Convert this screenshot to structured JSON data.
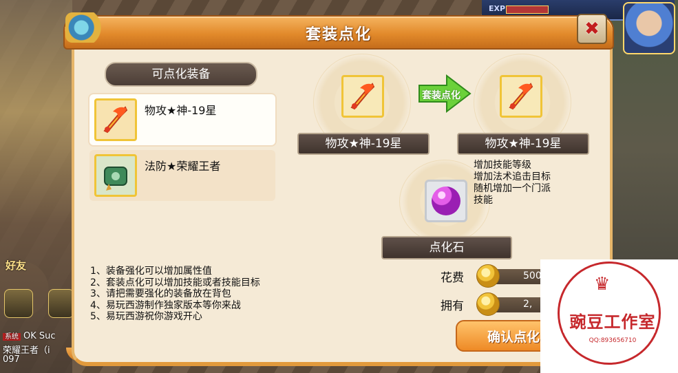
{
  "window": {
    "title": "套装点化",
    "close_icon": "close-icon"
  },
  "hud": {
    "exp_label": "EXP",
    "friend_label": "好友"
  },
  "chat": {
    "line1_tag": "系统",
    "line1_text": "OK  Suc",
    "line2_text": "荣耀王者（i",
    "line3_text": "097"
  },
  "left": {
    "section_label": "可点化装备",
    "items": [
      {
        "name": "物攻★神-19星",
        "icon": "flaming-sword-icon",
        "selected": true
      },
      {
        "name": "法防★荣耀王者",
        "icon": "jade-armor-icon",
        "selected": false
      }
    ]
  },
  "transform": {
    "arrow_label": "套装点化",
    "source_name": "物攻★神-19星",
    "target_name": "物攻★神-19星",
    "effects": [
      "增加技能等级",
      "增加法术追击目标",
      "随机增加一个门派",
      "技能"
    ]
  },
  "stone": {
    "label": "点化石",
    "icon": "purple-orb-icon"
  },
  "notes": [
    "1、装备强化可以增加属性值",
    "2、套装点化可以增加技能或者技能目标",
    "3、请把需要强化的装备放在背包",
    "4、易玩西游制作独家版本等你来战",
    "5、易玩西游祝你游戏开心"
  ],
  "cost": {
    "cost_label": "花费",
    "cost_value": "500",
    "own_label": "拥有",
    "own_value": "2,"
  },
  "confirm_label": "确认点化",
  "watermark": {
    "title": "豌豆工作室",
    "qq": "QQ:893656710"
  },
  "colors": {
    "title_orange": "#e28a2b",
    "accent_gold": "#f0c437",
    "panel": "#f5ead6",
    "watermark_red": "#c6282c"
  }
}
